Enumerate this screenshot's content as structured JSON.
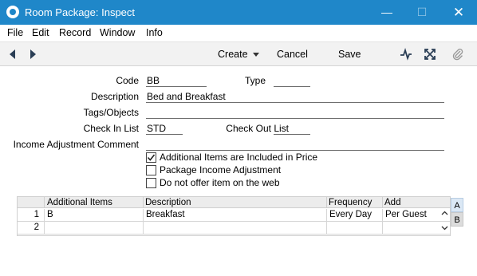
{
  "window": {
    "title": "Room Package: Inspect",
    "minimize_symbol": "—",
    "maximize_symbol": "☐",
    "close_symbol": "✕"
  },
  "menu": [
    "File",
    "Edit",
    "Record",
    "Window",
    "Info"
  ],
  "toolbar": {
    "create_label": "Create",
    "cancel_label": "Cancel",
    "save_label": "Save"
  },
  "form": {
    "code_label": "Code",
    "code_value": "BB",
    "type_label": "Type",
    "type_value": "",
    "description_label": "Description",
    "description_value": "Bed and Breakfast",
    "tags_label": "Tags/Objects",
    "tags_value": "",
    "check_in_label": "Check In List",
    "check_in_value": "STD",
    "check_out_label": "Check Out List",
    "check_out_value": "",
    "income_label": "Income Adjustment Comment",
    "income_value": "",
    "checkboxes": [
      {
        "label": "Additional Items are Included in Price",
        "checked": true
      },
      {
        "label": "Package Income Adjustment",
        "checked": false
      },
      {
        "label": "Do not offer item on the web",
        "checked": false
      }
    ]
  },
  "grid": {
    "headers": [
      "Additional Items",
      "Description",
      "Frequency",
      "Add"
    ],
    "rows": [
      {
        "num": "1",
        "item": "B",
        "description": "Breakfast",
        "frequency": "Every Day",
        "add": "Per Guest"
      },
      {
        "num": "2",
        "item": "",
        "description": "",
        "frequency": "",
        "add": ""
      }
    ]
  },
  "side_tabs": [
    "A",
    "B"
  ],
  "icons": [
    "app-logo-icon",
    "prev-record-icon",
    "next-record-icon",
    "activity-icon",
    "expand-icon",
    "attachment-icon"
  ]
}
